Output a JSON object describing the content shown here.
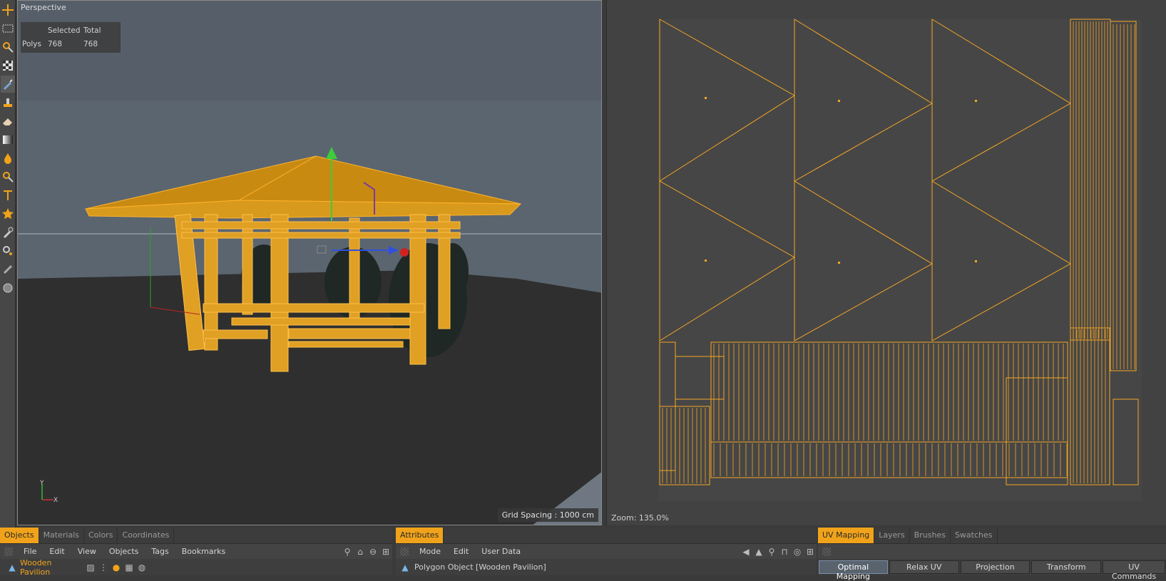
{
  "viewport": {
    "title": "Perspective",
    "stats": {
      "header_selected": "Selected",
      "header_total": "Total",
      "row_label": "Polys",
      "selected": "768",
      "total": "768"
    },
    "grid_spacing": "Grid Spacing : 1000 cm",
    "axis_y": "Y",
    "axis_x": "X"
  },
  "uv_editor": {
    "zoom": "Zoom: 135.0%"
  },
  "objects_panel": {
    "tabs": [
      {
        "label": "Objects",
        "active": true
      },
      {
        "label": "Materials",
        "active": false
      },
      {
        "label": "Colors",
        "active": false
      },
      {
        "label": "Coordinates",
        "active": false
      }
    ],
    "menu": [
      "File",
      "Edit",
      "View",
      "Objects",
      "Tags",
      "Bookmarks"
    ],
    "object_name": "Wooden Pavilion"
  },
  "attributes_panel": {
    "tab": "Attributes",
    "menu": [
      "Mode",
      "Edit",
      "User Data"
    ],
    "object_label": "Polygon Object [Wooden Pavilion]"
  },
  "uv_panel": {
    "tabs": [
      {
        "label": "UV Mapping",
        "active": true
      },
      {
        "label": "Layers",
        "active": false
      },
      {
        "label": "Brushes",
        "active": false
      },
      {
        "label": "Swatches",
        "active": false
      }
    ],
    "buttons": [
      {
        "label": "Optimal Mapping",
        "active": true
      },
      {
        "label": "Relax UV",
        "active": false
      },
      {
        "label": "Projection",
        "active": false
      },
      {
        "label": "Transform",
        "active": false
      },
      {
        "label": "UV Commands",
        "active": false
      }
    ]
  },
  "colors": {
    "accent": "#f0a31a",
    "wire": "#f5a623",
    "uv_background": "#424242",
    "sky": "#5b6570",
    "ground": "#2f2f2f"
  },
  "icons": [
    "move-icon",
    "rect-select-icon",
    "live-select-icon",
    "checker-icon",
    "brush-icon",
    "stamp-icon",
    "eraser-icon",
    "gradient-icon",
    "fill-icon",
    "magnifier-icon",
    "text-icon",
    "star-icon",
    "eyedropper-icon",
    "clone-icon",
    "smudge-icon",
    "sphere-icon"
  ]
}
